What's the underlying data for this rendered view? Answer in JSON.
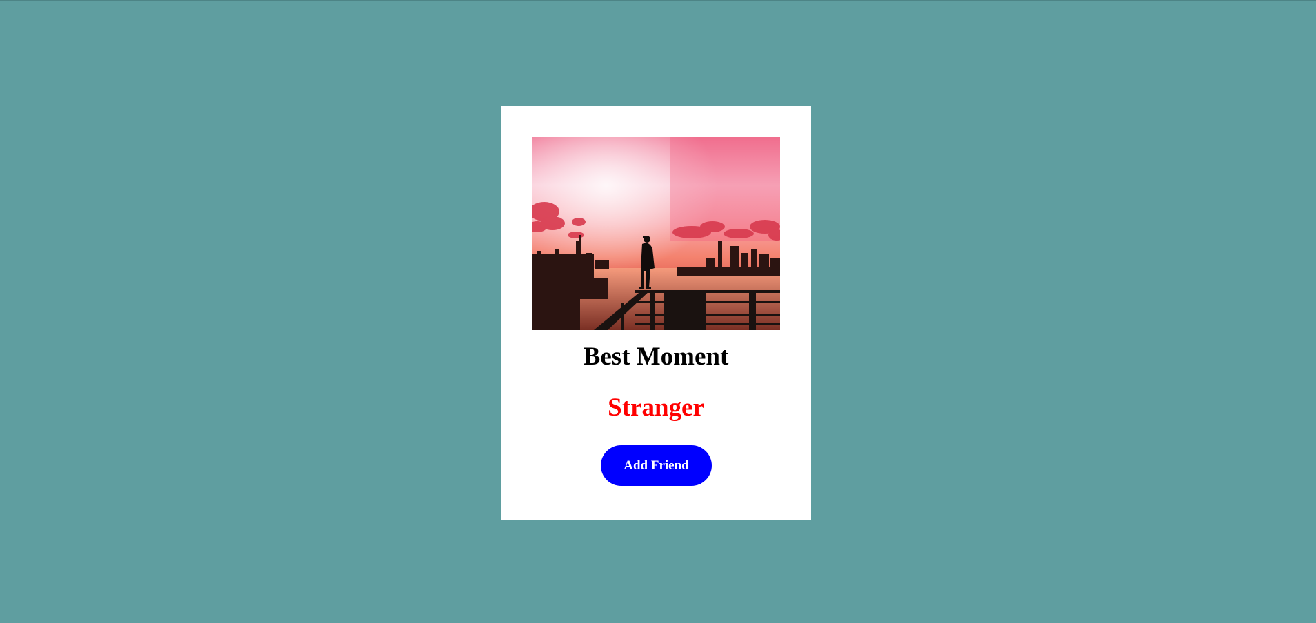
{
  "card": {
    "image_alt": "Silhouette of a person standing on a rooftop ledge above a city skyline at sunset",
    "title": "Best Moment",
    "subtitle": "Stranger",
    "button_label": "Add Friend"
  },
  "colors": {
    "page_background": "#5f9ea0",
    "card_background": "#ffffff",
    "subtitle": "#ff0000",
    "button_background": "#0000ff",
    "button_text": "#ffffff"
  }
}
